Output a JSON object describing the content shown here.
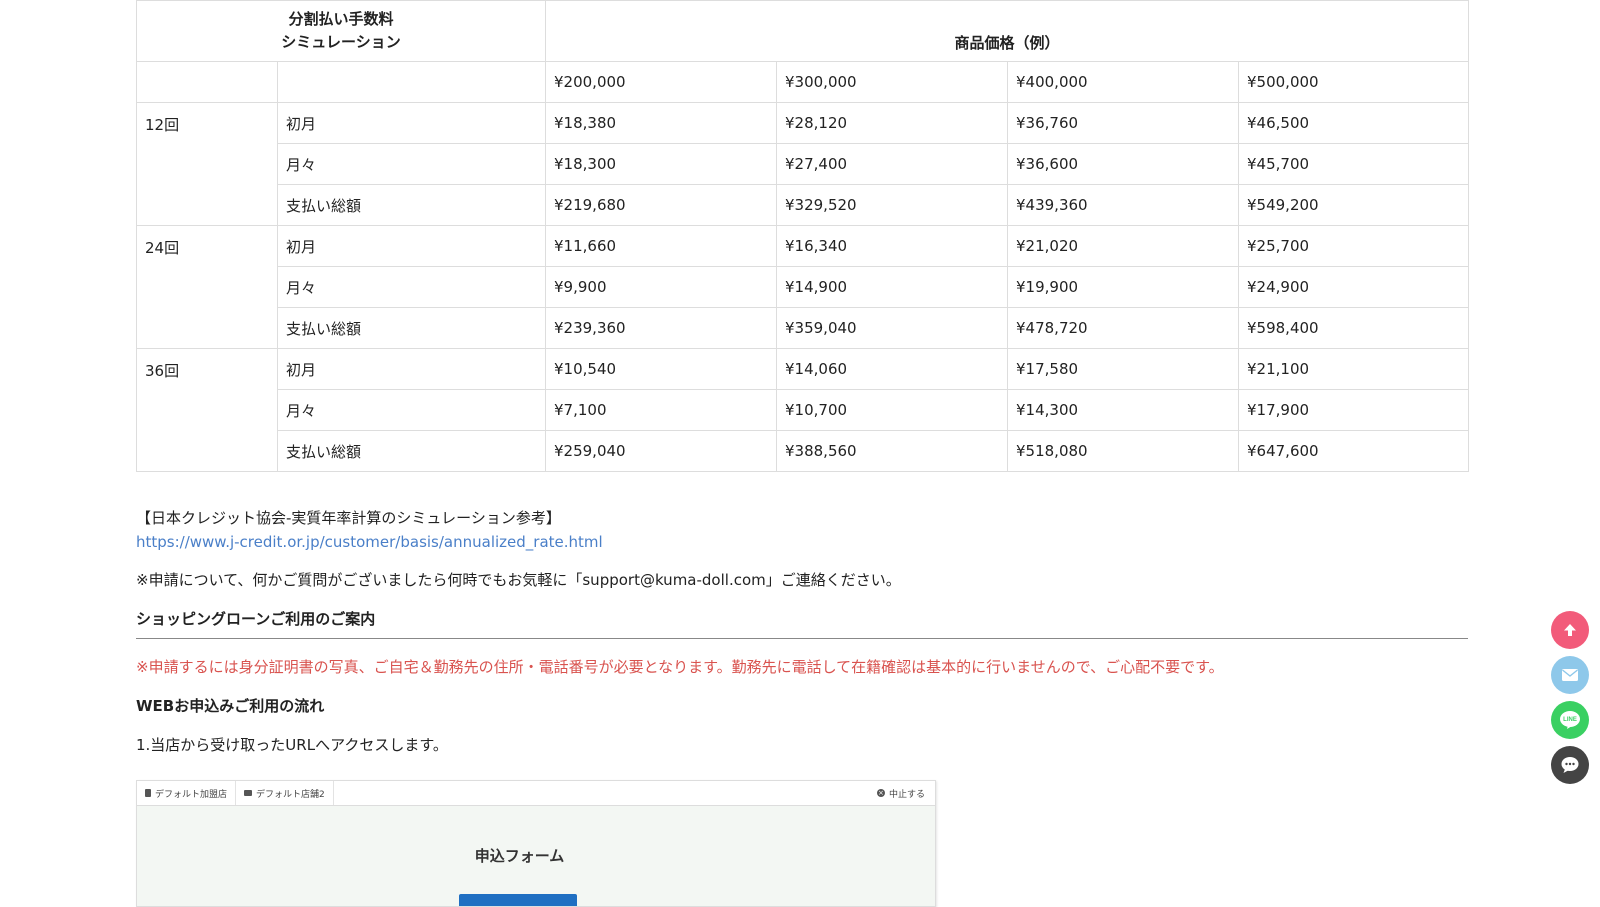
{
  "table": {
    "header_left_line1": "分割払い手数料",
    "header_left_line2": "シミュレーション",
    "header_right": "商品価格（例）",
    "prices": [
      "¥200,000",
      "¥300,000",
      "¥400,000",
      "¥500,000"
    ],
    "groups": [
      {
        "count": "12回",
        "rows": [
          {
            "label": "初月",
            "values": [
              "¥18,380",
              "¥28,120",
              "¥36,760",
              "¥46,500"
            ]
          },
          {
            "label": "月々",
            "values": [
              "¥18,300",
              "¥27,400",
              "¥36,600",
              "¥45,700"
            ]
          },
          {
            "label": "支払い総額",
            "values": [
              "¥219,680",
              "¥329,520",
              "¥439,360",
              "¥549,200"
            ]
          }
        ]
      },
      {
        "count": "24回",
        "rows": [
          {
            "label": "初月",
            "values": [
              "¥11,660",
              "¥16,340",
              "¥21,020",
              "¥25,700"
            ]
          },
          {
            "label": "月々",
            "values": [
              "¥9,900",
              "¥14,900",
              "¥19,900",
              "¥24,900"
            ]
          },
          {
            "label": "支払い総額",
            "values": [
              "¥239,360",
              "¥359,040",
              "¥478,720",
              "¥598,400"
            ]
          }
        ]
      },
      {
        "count": "36回",
        "rows": [
          {
            "label": "初月",
            "values": [
              "¥10,540",
              "¥14,060",
              "¥17,580",
              "¥21,100"
            ]
          },
          {
            "label": "月々",
            "values": [
              "¥7,100",
              "¥10,700",
              "¥14,300",
              "¥17,900"
            ]
          },
          {
            "label": "支払い総額",
            "values": [
              "¥259,040",
              "¥388,560",
              "¥518,080",
              "¥647,600"
            ]
          }
        ]
      }
    ]
  },
  "reference": {
    "heading": "【日本クレジット協会-実質年率計算のシミュレーション参考】",
    "link": "https://www.j-credit.or.jp/customer/basis/annualized_rate.html"
  },
  "contact_note": "※申請について、何かご質問がございましたら何時でもお気軽に「support@kuma-doll.com」ご連絡ください。",
  "section_title": "ショッピングローンご利用のご案内",
  "red_note": "※申請するには身分証明書の写真、ご自宅＆勤務先の住所・電話番号が必要となります。勤務先に電話して在籍確認は基本的に行いませんので、ご心配不要です。",
  "flow_title": "WEBお申込みご利用の流れ",
  "step1": "1.当店から受け取ったURLへアクセスします。",
  "screenshot": {
    "tab1": "デフォルト加盟店",
    "tab2": "デフォルト店舗2",
    "stop": "中止する",
    "title": "申込フォーム"
  },
  "fabs": {
    "scroll_top_color": "#f25b7a",
    "mail_color": "#8ec8ea",
    "line_color": "#3ad062",
    "line_label": "LINE",
    "chat_color": "#444444"
  }
}
